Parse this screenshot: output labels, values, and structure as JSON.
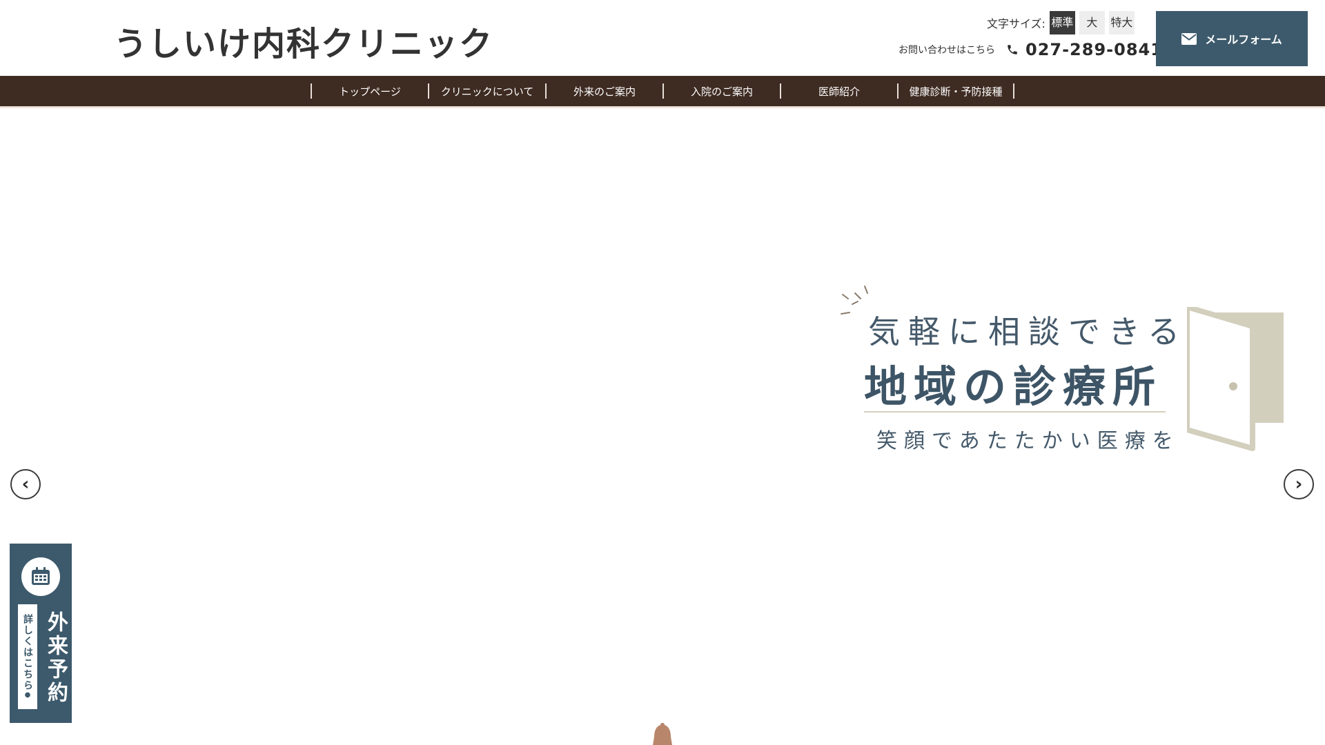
{
  "header": {
    "logo": "うしいけ内科クリニック",
    "font_size_label": "文字サイズ:",
    "font_size_options": [
      "標準",
      "大",
      "特大"
    ],
    "font_size_selected": "標準",
    "contact_label": "お問い合わせはこちら",
    "phone": "027-289-0841",
    "mail_button": "メールフォーム"
  },
  "nav": {
    "items": [
      "トップページ",
      "クリニックについて",
      "外来のご案内",
      "入院のご案内",
      "医師紹介",
      "健康診断・予防接種"
    ]
  },
  "hero": {
    "tagline_small": "気軽に相談できる",
    "tagline_big": "地域の診療所",
    "tagline_sub": "笑顔であたたかい医療を",
    "prev_arrow": "‹",
    "next_arrow": "›"
  },
  "side_tab": {
    "title": "外来予約",
    "details": "詳しくはこちら",
    "details_glyph": "●"
  },
  "colors": {
    "nav_bg": "#3e2b22",
    "accent_blue": "#3d5a6c",
    "door": "#d3cfbd",
    "bell": "#b8866a"
  },
  "icons": [
    "phone-icon",
    "mail-icon",
    "calendar-icon",
    "door-icon",
    "sparkle-icon",
    "bell-icon"
  ]
}
